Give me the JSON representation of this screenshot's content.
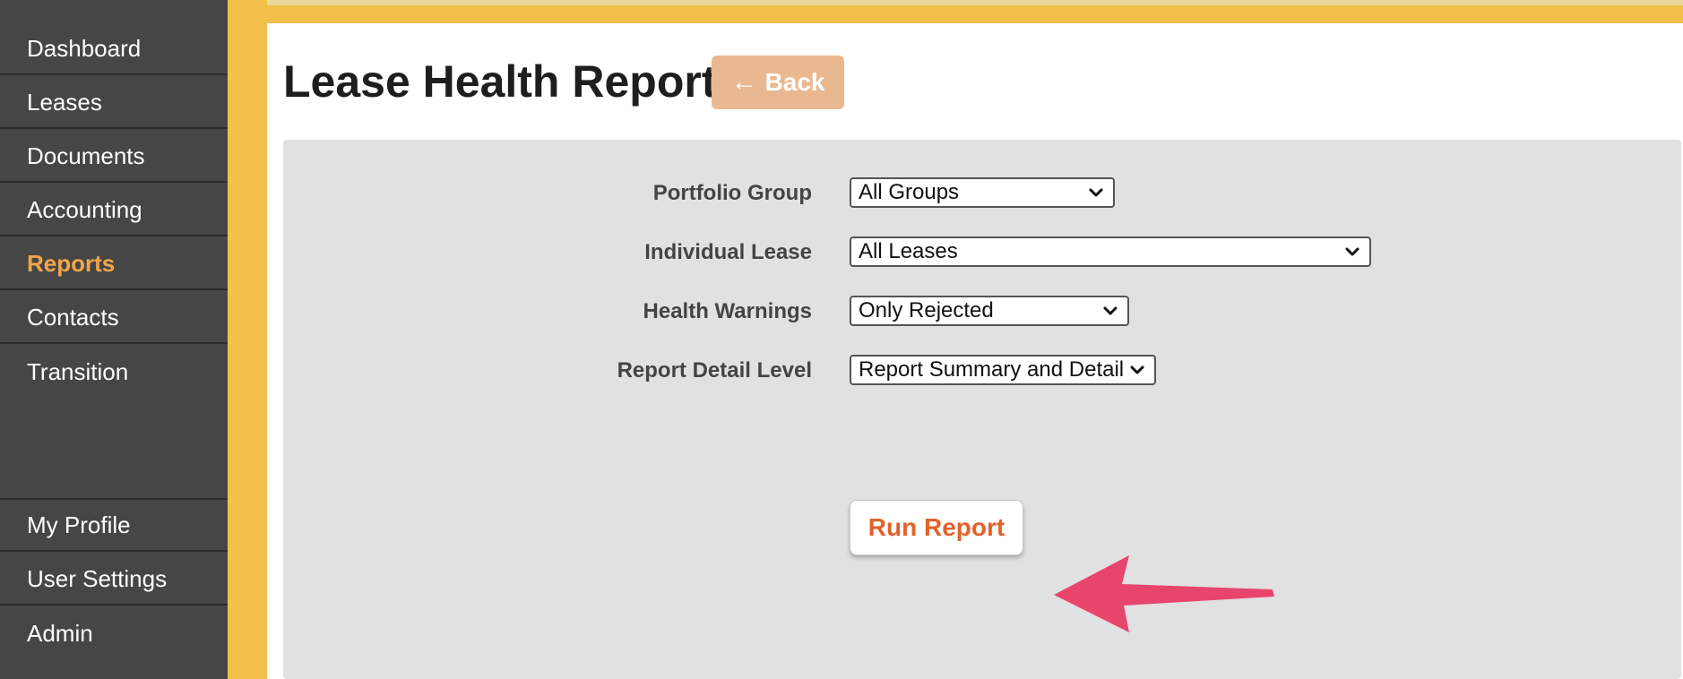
{
  "sidebar": {
    "items": [
      {
        "label": "Dashboard"
      },
      {
        "label": "Leases"
      },
      {
        "label": "Documents"
      },
      {
        "label": "Accounting"
      },
      {
        "label": "Reports",
        "active": true
      },
      {
        "label": "Contacts"
      },
      {
        "label": "Transition"
      }
    ],
    "bottom_items": [
      {
        "label": "My Profile"
      },
      {
        "label": "User Settings"
      },
      {
        "label": "Admin"
      }
    ]
  },
  "page": {
    "title": "Lease Health Report",
    "back_arrow": "←",
    "back_label": "Back"
  },
  "form": {
    "portfolio_group": {
      "label": "Portfolio Group",
      "value": "All Groups"
    },
    "individual_lease": {
      "label": "Individual Lease",
      "value": "All Leases"
    },
    "health_warnings": {
      "label": "Health Warnings",
      "value": "Only Rejected"
    },
    "report_detail_level": {
      "label": "Report Detail Level",
      "value": "Report Summary and Detail"
    },
    "run_label": "Run Report"
  },
  "colors": {
    "sidebar_bg": "#464646",
    "active_nav": "#f2a64a",
    "frame_yellow": "#f2c14a",
    "back_button_bg": "#eab890",
    "run_button_text": "#e2612b",
    "annotation_arrow": "#e8456e"
  }
}
